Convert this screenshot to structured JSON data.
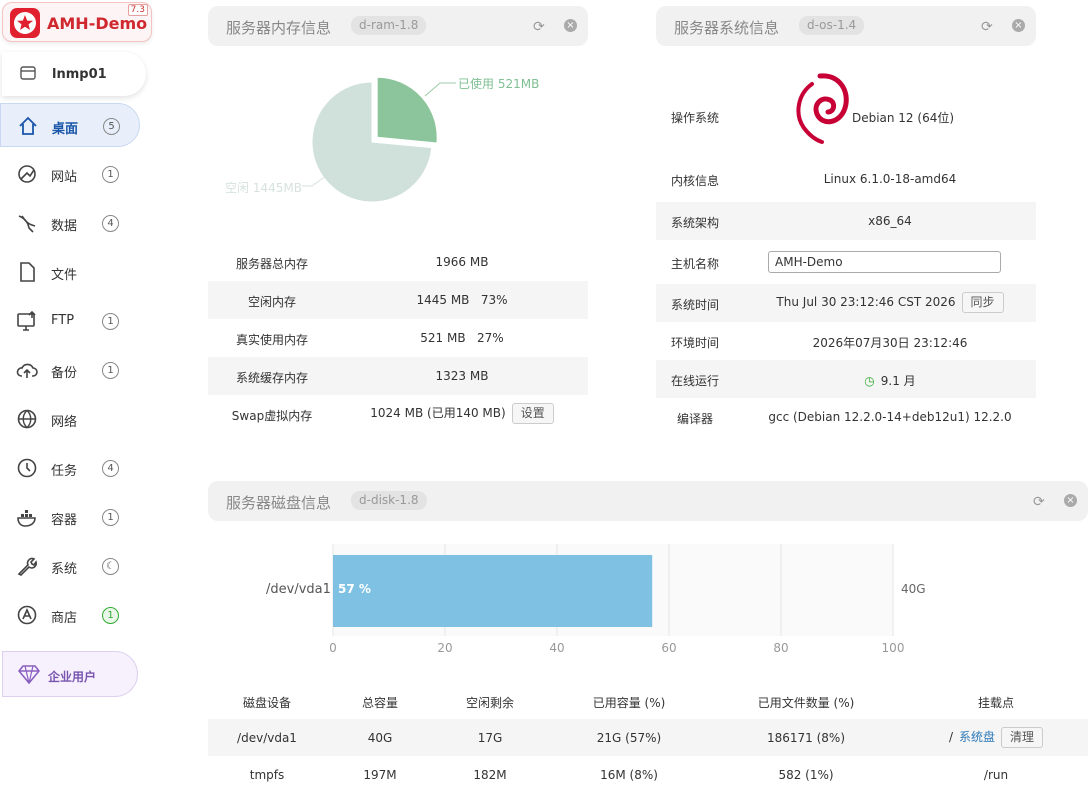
{
  "brand": {
    "name": "AMH-Demo",
    "version": "7.3"
  },
  "host": {
    "name": "lnmp01"
  },
  "sidebar": {
    "items": [
      {
        "label": "桌面",
        "badge": "5",
        "icon": "home-icon"
      },
      {
        "label": "网站",
        "badge": "1",
        "icon": "website-icon"
      },
      {
        "label": "数据",
        "badge": "4",
        "icon": "database-icon"
      },
      {
        "label": "文件",
        "badge": "",
        "icon": "file-icon"
      },
      {
        "label": "FTP",
        "badge": "1",
        "icon": "ftp-icon"
      },
      {
        "label": "备份",
        "badge": "1",
        "icon": "backup-icon"
      },
      {
        "label": "网络",
        "badge": "",
        "icon": "globe-icon"
      },
      {
        "label": "任务",
        "badge": "4",
        "icon": "clock-icon"
      },
      {
        "label": "容器",
        "badge": "1",
        "icon": "container-icon"
      },
      {
        "label": "系统",
        "badge": "",
        "icon": "wrench-icon"
      },
      {
        "label": "商店",
        "badge": "1",
        "icon": "store-icon"
      }
    ],
    "enterprise": "企业用户"
  },
  "ram": {
    "title": "服务器内存信息",
    "tag": "d-ram-1.8",
    "chart_data": {
      "type": "pie",
      "slices": [
        {
          "label": "已使用 521MB",
          "value": 521,
          "color": "#8cc49c"
        },
        {
          "label": "空闲 1445MB",
          "value": 1445,
          "color": "#d0e0db"
        }
      ]
    },
    "rows": [
      {
        "label": "服务器总内存",
        "value": "1966 MB"
      },
      {
        "label": "空闲内存",
        "value": "1445 MB   73%"
      },
      {
        "label": "真实使用内存",
        "value": "521 MB   27%"
      },
      {
        "label": "系统缓存内存",
        "value": "1323 MB"
      },
      {
        "label": "Swap虚拟内存",
        "value": "1024 MB (已用140 MB)",
        "button": "设置"
      }
    ]
  },
  "os": {
    "title": "服务器系统信息",
    "tag": "d-os-1.4",
    "rows": [
      {
        "label": "操作系统",
        "value": "Debian 12 (64位)"
      },
      {
        "label": "内核信息",
        "value": "Linux 6.1.0-18-amd64"
      },
      {
        "label": "系统架构",
        "value": "x86_64"
      },
      {
        "label": "主机名称",
        "value": "AMH-Demo"
      },
      {
        "label": "系统时间",
        "value": "Thu Jul 30 23:12:46 CST 2026",
        "button": "同步"
      },
      {
        "label": "环境时间",
        "value": "2026年07月30日 23:12:46"
      },
      {
        "label": "在线运行",
        "value": "9.1 月"
      },
      {
        "label": "编译器",
        "value": "gcc (Debian 12.2.0-14+deb12u1) 12.2.0"
      }
    ]
  },
  "disk": {
    "title": "服务器磁盘信息",
    "tag": "d-disk-1.8",
    "chart_data": {
      "type": "bar",
      "orientation": "horizontal",
      "categories": [
        "/dev/vda1"
      ],
      "values": [
        57
      ],
      "bar_label": "57 %",
      "right_label": "40G",
      "xlim": [
        0,
        100
      ],
      "ticks": [
        "0",
        "20",
        "40",
        "60",
        "80",
        "100"
      ],
      "color": "#7ec1e3"
    },
    "headers": [
      "磁盘设备",
      "总容量",
      "空闲剩余",
      "已用容量 (%)",
      "已用文件数量 (%)",
      "挂载点"
    ],
    "rows": [
      {
        "device": "/dev/vda1",
        "total": "40G",
        "free": "17G",
        "used": "21G (57%)",
        "files": "186171 (8%)",
        "mount": "/",
        "mount_link": "系统盘",
        "button": "清理"
      },
      {
        "device": "tmpfs",
        "total": "197M",
        "free": "182M",
        "used": "16M (8%)",
        "files": "582 (1%)",
        "mount": "/run",
        "mount_link": "",
        "button": ""
      }
    ]
  }
}
